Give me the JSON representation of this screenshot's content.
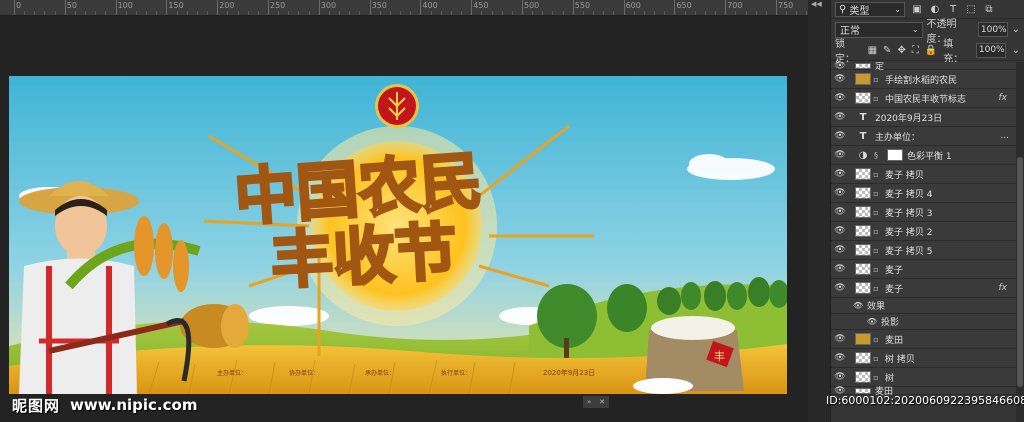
{
  "ruler": {
    "labels": [
      "0",
      "50",
      "100",
      "150",
      "200",
      "250",
      "300",
      "350",
      "400",
      "450",
      "500",
      "550",
      "600",
      "650",
      "700",
      "750"
    ]
  },
  "canvas": {
    "logo_top_text": "中国农民丰收节",
    "title_line1": "中国农民",
    "title_line2": "丰收节",
    "info": [
      "主办单位：",
      "协办单位：",
      "承办单位：",
      "执行单位：",
      "2020年9月23日"
    ],
    "sack_badge": "丰"
  },
  "watermark": {
    "logo": "昵图网",
    "url": "www.nipic.com"
  },
  "mini_bar": {
    "icons": [
      "double-chevron-icon",
      "close-icon"
    ]
  },
  "panel": {
    "filter_kind": "类型",
    "blend_mode": "正常",
    "opacity_label": "不透明度：",
    "opacity_value": "100%",
    "lock_label": "锁定：",
    "fill_label": "填充：",
    "fill_value": "100%",
    "layers": [
      {
        "name": "定",
        "type": "partial"
      },
      {
        "name": "手绘割水稻的农民",
        "type": "image",
        "thumb": "gold"
      },
      {
        "name": "中国农民丰收节标志",
        "type": "image",
        "fx": "fx"
      },
      {
        "name": "2020年9月23日",
        "type": "text"
      },
      {
        "name": "主办单位：",
        "type": "text",
        "more": "..."
      },
      {
        "name": "色彩平衡 1",
        "type": "adjust"
      },
      {
        "name": "麦子 拷贝",
        "type": "image"
      },
      {
        "name": "麦子 拷贝 4",
        "type": "image"
      },
      {
        "name": "麦子 拷贝 3",
        "type": "image"
      },
      {
        "name": "麦子 拷贝 2",
        "type": "image"
      },
      {
        "name": "麦子 拷贝 5",
        "type": "image"
      },
      {
        "name": "麦子",
        "type": "image"
      },
      {
        "name": "麦子",
        "type": "image",
        "fx": "fx"
      },
      {
        "name": "效果",
        "type": "effects"
      },
      {
        "name": "投影",
        "type": "effect-item"
      },
      {
        "name": "麦田",
        "type": "image",
        "thumb": "gold"
      },
      {
        "name": "树 拷贝",
        "type": "image"
      },
      {
        "name": "树",
        "type": "image"
      },
      {
        "name": "麦田",
        "type": "partial"
      }
    ]
  },
  "id_text": "ID:6000102:20200609223958466086"
}
